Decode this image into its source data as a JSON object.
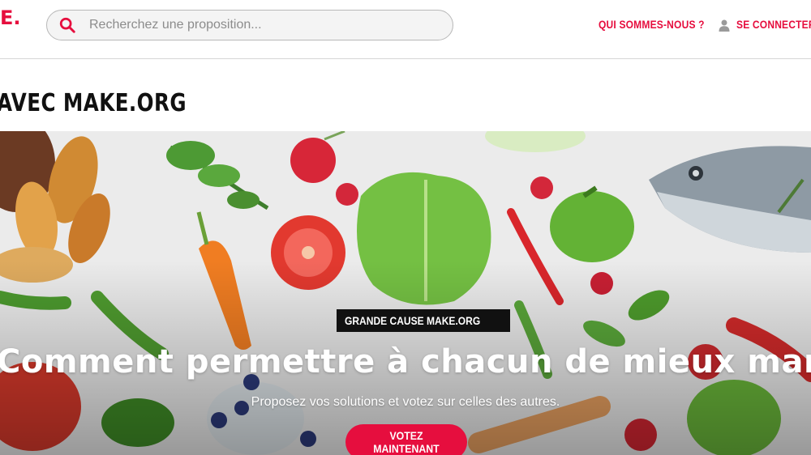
{
  "header": {
    "logo_fragment": "E.",
    "search": {
      "placeholder": "Recherchez une proposition...",
      "value": "",
      "icon": "search-icon"
    },
    "nav": {
      "about_label": "QUI SOMMES-NOUS ?",
      "login_label": "SE CONNECTER",
      "login_icon": "user-icon"
    }
  },
  "page": {
    "title": "AVEC MAKE.ORG"
  },
  "hero": {
    "badge": "GRANDE CAUSE MAKE.ORG",
    "title": "Comment permettre à chacun de mieux manger ?",
    "subtitle": "Proposez vos solutions et votez sur celles des autres.",
    "cta_label": "VOTEZ MAINTENANT"
  },
  "colors": {
    "brand_red": "#e60e3e",
    "brand_blue": "#1f2a88",
    "badge_bg": "#111111"
  }
}
